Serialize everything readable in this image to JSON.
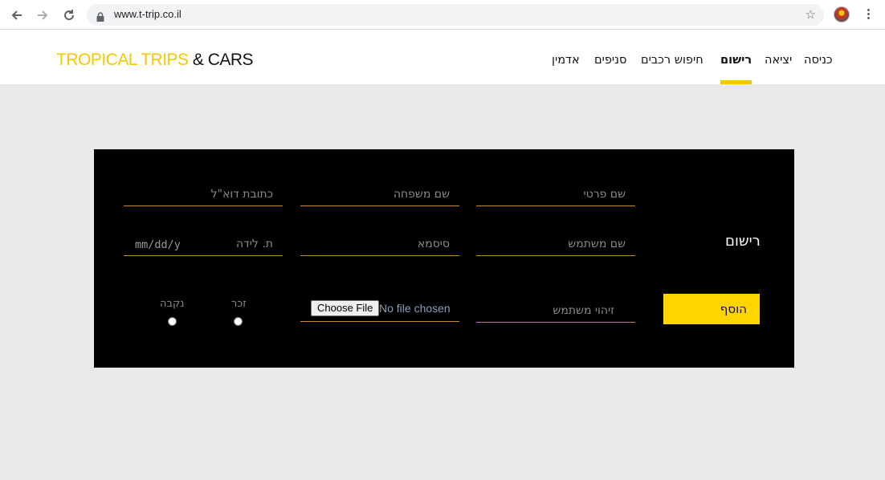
{
  "browser": {
    "url": "www.t-trip.co.il"
  },
  "header": {
    "logo_part1": "TROPICAL TRIPS",
    "logo_part2": " & CARS",
    "nav": {
      "login": "כניסה",
      "logout": "יציאה",
      "register": "רישום",
      "car_search": "חיפוש רכבים",
      "branches": "סניפים",
      "admin": "אדמין"
    }
  },
  "form": {
    "title": "רישום",
    "first_name_placeholder": "שם פרטי",
    "last_name_placeholder": "שם משפחה",
    "email_placeholder": "כתובת דוא\"ל",
    "username_placeholder": "שם משתמש",
    "password_placeholder": "סיסמא",
    "birth_date_label": "ת. לידה",
    "birth_date_format": "mm/dd/y",
    "user_id_placeholder": "זיהוי משתמש",
    "file_button": "Choose File",
    "file_status": "No file chosen",
    "gender_male": "זכר",
    "gender_female": "נקבה",
    "submit": "הוסף"
  },
  "colors": {
    "accent": "#f5c800",
    "panel": "#000000",
    "page_bg": "#e9e9e9",
    "field_underline": "#c98a2a"
  }
}
